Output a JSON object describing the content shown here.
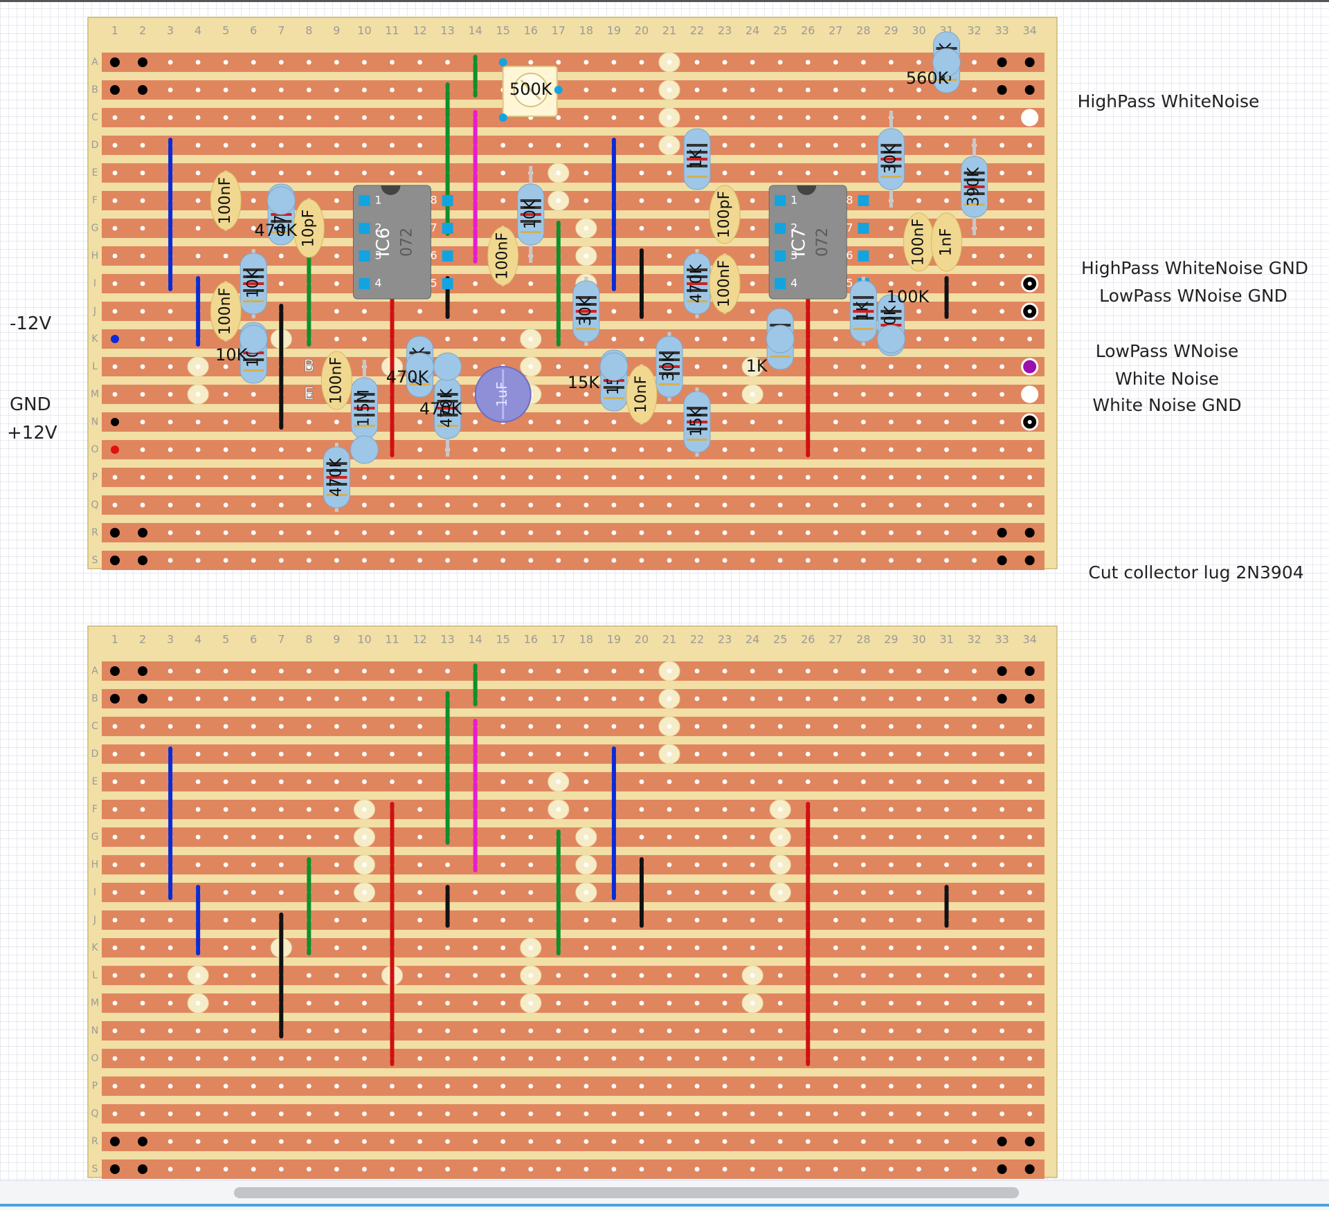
{
  "colors": {
    "board": "#f1dfa5",
    "strip": "#e0865f",
    "hole": "#ffffff",
    "wire_blue": "#0a2bd6",
    "wire_green": "#0f8f2a",
    "wire_magenta": "#e81bd0",
    "wire_red": "#d01010",
    "wire_black": "#111111",
    "resistor_body": "#9ec6e6",
    "cap_body": "#f0d890",
    "ic_body": "#8e8e8e",
    "electrolytic": "#8f8fd8",
    "cut_mark": "#f6edc8"
  },
  "grid": {
    "columns": [
      "1",
      "2",
      "3",
      "4",
      "5",
      "6",
      "7",
      "8",
      "9",
      "10",
      "11",
      "12",
      "13",
      "14",
      "15",
      "16",
      "17",
      "18",
      "19",
      "20",
      "21",
      "22",
      "23",
      "24",
      "25",
      "26",
      "27",
      "28",
      "29",
      "30",
      "31",
      "32",
      "33",
      "34"
    ],
    "rows": [
      "A",
      "B",
      "C",
      "D",
      "E",
      "F",
      "G",
      "H",
      "I",
      "J",
      "K",
      "L",
      "M",
      "N",
      "O",
      "P",
      "Q",
      "R",
      "S"
    ]
  },
  "rail_labels": {
    "neg12": "-12V",
    "gnd": "GND",
    "pos12": "+12V"
  },
  "output_labels": {
    "highpass": "HighPass WhiteNoise",
    "highpass_gnd": "HighPass WhiteNoise GND",
    "lowpass_gnd": "LowPass WNoise GND",
    "lowpass": "LowPass WNoise",
    "white": "White Noise",
    "white_gnd": "White Noise GND"
  },
  "note": "Cut collector lug 2N3904",
  "transistor_pins": {
    "base": "B",
    "emitter": "E"
  },
  "ics": [
    {
      "id": "IC6",
      "type": "072",
      "pins": [
        "1",
        "2",
        "3",
        "4",
        "5",
        "6",
        "7",
        "8"
      ]
    },
    {
      "id": "IC7",
      "type": "072",
      "pins": [
        "1",
        "2",
        "3",
        "4",
        "5",
        "6",
        "7",
        "8"
      ]
    }
  ],
  "components": [
    {
      "name": "resistor-10k-a",
      "kind": "resistor",
      "value": "10K",
      "at": [
        6,
        "H"
      ],
      "to": [
        6,
        "J"
      ]
    },
    {
      "name": "resistor-470k-a",
      "kind": "resistor",
      "value": "470K",
      "at": [
        7,
        "F"
      ],
      "to": [
        7,
        "G"
      ]
    },
    {
      "name": "resistor-10k-b",
      "kind": "resistor",
      "value": "10K",
      "at": [
        6,
        "K"
      ],
      "to": [
        6,
        "L"
      ]
    },
    {
      "name": "resistor-1-5m",
      "kind": "resistor",
      "value": "1.5M",
      "at": [
        10,
        "L"
      ],
      "to": [
        10,
        "O"
      ]
    },
    {
      "name": "resistor-470k-b",
      "kind": "resistor",
      "value": "470K",
      "at": [
        9,
        "O"
      ],
      "to": [
        9,
        "Q"
      ]
    },
    {
      "name": "resistor-470k-c",
      "kind": "resistor",
      "value": "470K",
      "at": [
        12,
        "L"
      ],
      "to": [
        12,
        "L"
      ]
    },
    {
      "name": "resistor-470k-d",
      "kind": "resistor",
      "value": "470K",
      "at": [
        13,
        "L"
      ],
      "to": [
        13,
        "O"
      ]
    },
    {
      "name": "resistor-10k-c",
      "kind": "resistor",
      "value": "10K",
      "at": [
        16,
        "E"
      ],
      "to": [
        16,
        "H"
      ]
    },
    {
      "name": "resistor-30k-a",
      "kind": "resistor",
      "value": "30K",
      "at": [
        18,
        "I"
      ],
      "to": [
        18,
        "K"
      ]
    },
    {
      "name": "resistor-15k-a",
      "kind": "resistor",
      "value": "15K",
      "at": [
        19,
        "L"
      ],
      "to": [
        19,
        "M"
      ]
    },
    {
      "name": "resistor-30k-b",
      "kind": "resistor",
      "value": "30K",
      "at": [
        21,
        "K"
      ],
      "to": [
        21,
        "M"
      ]
    },
    {
      "name": "resistor-1k-a",
      "kind": "resistor",
      "value": "1K",
      "at": [
        22,
        "D"
      ],
      "to": [
        22,
        "E"
      ]
    },
    {
      "name": "resistor-470k-e",
      "kind": "resistor",
      "value": "470K",
      "at": [
        22,
        "H"
      ],
      "to": [
        22,
        "J"
      ]
    },
    {
      "name": "resistor-15k-b",
      "kind": "resistor",
      "value": "15K",
      "at": [
        22,
        "M"
      ],
      "to": [
        22,
        "O"
      ]
    },
    {
      "name": "resistor-1k-b",
      "kind": "resistor",
      "value": "1K",
      "at": [
        25,
        "K"
      ],
      "to": [
        25,
        "K"
      ]
    },
    {
      "name": "resistor-1k-c",
      "kind": "resistor",
      "value": "1K",
      "at": [
        28,
        "I"
      ],
      "to": [
        28,
        "K"
      ]
    },
    {
      "name": "resistor-100k",
      "kind": "resistor",
      "value": "100K",
      "at": [
        29,
        "J"
      ],
      "to": [
        29,
        "K"
      ]
    },
    {
      "name": "resistor-30k-c",
      "kind": "resistor",
      "value": "30K",
      "at": [
        29,
        "C"
      ],
      "to": [
        29,
        "F"
      ]
    },
    {
      "name": "resistor-560k",
      "kind": "resistor",
      "value": "560K",
      "at": [
        31,
        "A"
      ],
      "to": [
        31,
        "A"
      ]
    },
    {
      "name": "resistor-390k",
      "kind": "resistor",
      "value": "390K",
      "at": [
        32,
        "D"
      ],
      "to": [
        32,
        "G"
      ]
    },
    {
      "name": "cap-100nf-a",
      "kind": "capacitor",
      "value": "100nF",
      "at": [
        5,
        "E"
      ],
      "to": [
        5,
        "G"
      ]
    },
    {
      "name": "cap-10pf",
      "kind": "capacitor",
      "value": "10pF",
      "at": [
        8,
        "F"
      ],
      "to": [
        8,
        "H"
      ]
    },
    {
      "name": "cap-100nf-b",
      "kind": "capacitor",
      "value": "100nF",
      "at": [
        5,
        "I"
      ],
      "to": [
        5,
        "K"
      ]
    },
    {
      "name": "cap-100nf-c",
      "kind": "capacitor",
      "value": "100nF",
      "at": [
        9,
        "L"
      ],
      "to": [
        9,
        "M"
      ]
    },
    {
      "name": "cap-100nf-d",
      "kind": "capacitor",
      "value": "100nF",
      "at": [
        15,
        "G"
      ],
      "to": [
        15,
        "I"
      ]
    },
    {
      "name": "cap-10nf",
      "kind": "capacitor",
      "value": "10nF",
      "at": [
        20,
        "L"
      ],
      "to": [
        20,
        "N"
      ]
    },
    {
      "name": "cap-100pf",
      "kind": "capacitor",
      "value": "100pF",
      "at": [
        23,
        "F"
      ],
      "to": [
        23,
        "G"
      ]
    },
    {
      "name": "cap-100nf-e",
      "kind": "capacitor",
      "value": "100nF",
      "at": [
        23,
        "H"
      ],
      "to": [
        23,
        "J"
      ]
    },
    {
      "name": "cap-100nf-f",
      "kind": "capacitor",
      "value": "100nF",
      "at": [
        30,
        "G"
      ],
      "to": [
        30,
        "H"
      ]
    },
    {
      "name": "cap-1nf",
      "kind": "capacitor",
      "value": "1nF",
      "at": [
        31,
        "G"
      ],
      "to": [
        31,
        "H"
      ]
    },
    {
      "name": "electrolytic-1uf",
      "kind": "electrolytic",
      "value": "1uF"
    },
    {
      "name": "trimpot-500k",
      "kind": "trimpot",
      "value": "500K"
    }
  ],
  "board_labels": [
    {
      "name": "label-470k-a",
      "text": "470K"
    },
    {
      "name": "label-10k-b",
      "text": "10K"
    },
    {
      "name": "label-470k-c",
      "text": "470K"
    },
    {
      "name": "label-470k-d",
      "text": "470K"
    },
    {
      "name": "label-15k-a",
      "text": "15K"
    },
    {
      "name": "label-1k-b",
      "text": "1K"
    },
    {
      "name": "label-100k",
      "text": "100K"
    },
    {
      "name": "label-560k",
      "text": "560K"
    },
    {
      "name": "label-500k",
      "text": "500K"
    }
  ]
}
